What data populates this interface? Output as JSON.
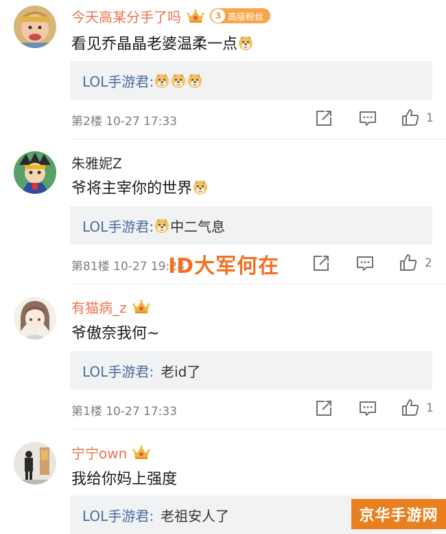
{
  "comments": [
    {
      "username": "今天高某分手了吗",
      "badge_level": "3",
      "badge_text": "高级粉丝",
      "text": "看见乔晶晶老婆温柔一点",
      "reply_author": "LOL手游君:",
      "reply_text": "",
      "floor": "第2楼",
      "time": "10-27 17:33",
      "likes": "1"
    },
    {
      "username": "朱雅妮Z",
      "text": "爷将主宰你的世界",
      "reply_author": "LOL手游君:",
      "reply_text": "中二气息",
      "floor": "第81楼",
      "time": "10-27 19:28",
      "likes": "2"
    },
    {
      "username": "有猫病_z",
      "text": "爷傲奈我何~",
      "reply_author": "LOL手游君:",
      "reply_text": "老id了",
      "floor": "第1楼",
      "time": "10-27 17:33",
      "likes": "1"
    },
    {
      "username": "宁宁own",
      "text": "我给你妈上强度",
      "reply_author": "LOL手游君:",
      "reply_text": "老祖安人了"
    }
  ],
  "watermark_text": "ID大军何在",
  "corner_watermark": "京华手游网",
  "colors": {
    "vip_name": "#eb7350",
    "reply_name": "#4a6d9c",
    "reply_bg": "#f1f2f3",
    "badge": "#f7a54a",
    "watermark": "#f46f1e"
  }
}
